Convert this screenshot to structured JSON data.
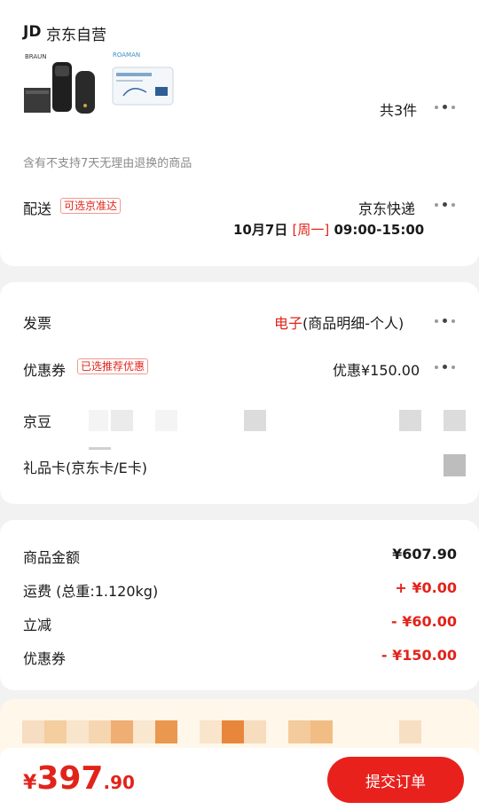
{
  "store": {
    "logo": "JD",
    "name": "京东自营"
  },
  "products": {
    "count_label": "共3件",
    "thumb1_brand": "BRAUN",
    "thumb2_brand": "ROAMAN",
    "notice": "含有不支持7天无理由退换的商品"
  },
  "delivery": {
    "label": "配送",
    "tag": "可选京准达",
    "carrier": "京东快递",
    "date": "10月7日",
    "weekday": "[周一]",
    "time": "09:00-15:00"
  },
  "invoice": {
    "label": "发票",
    "value_type": "电子",
    "value_detail": "(商品明细-个人)"
  },
  "coupon": {
    "label": "优惠券",
    "tag": "已选推荐优惠",
    "value": "优惠¥150.00"
  },
  "jingdou": {
    "label": "京豆"
  },
  "giftcard": {
    "label": "礼品卡(京东卡/E卡)"
  },
  "summary": {
    "rows": [
      {
        "label": "商品金额",
        "value": "¥607.90"
      },
      {
        "label": "运费 (总重:1.120kg)",
        "value": "+ ¥0.00"
      },
      {
        "label": "立减",
        "value": "- ¥60.00"
      },
      {
        "label": "优惠券",
        "value": "- ¥150.00"
      }
    ]
  },
  "footer": {
    "currency": "¥",
    "total_int": "397",
    "total_dec": ".90",
    "submit_label": "提交订单"
  },
  "colors": {
    "accent": "#e2231a",
    "button": "#e8211d"
  },
  "icons": [
    "more-dots-icon"
  ]
}
